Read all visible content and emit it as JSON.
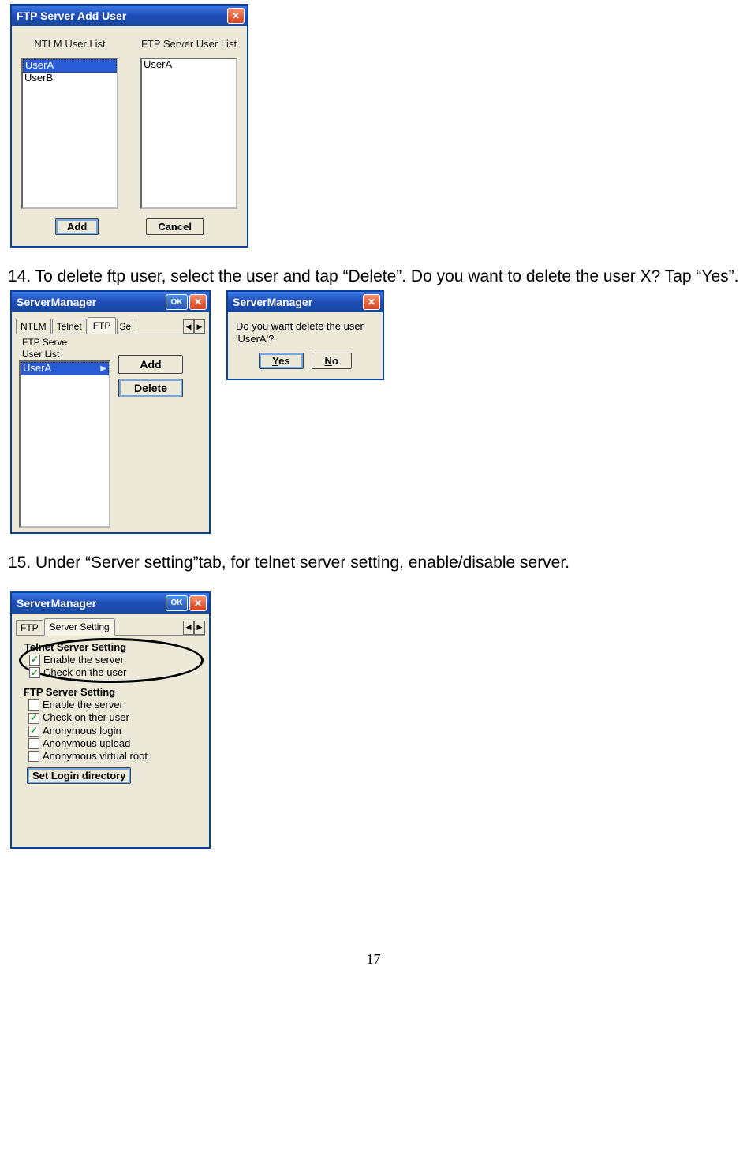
{
  "page_number": "17",
  "dialog1": {
    "title": "FTP Server Add User",
    "ntlm_label": "NTLM User List",
    "ftp_label": "FTP Server User List",
    "ntlm_users": [
      "UserA",
      "UserB"
    ],
    "ftp_users": [
      "UserA"
    ],
    "add_label": "Add",
    "cancel_label": "Cancel"
  },
  "para14": "14. To delete ftp user, select the user and tap “Delete”. Do you want to delete the user X? Tap “Yes”.",
  "dialog2": {
    "title": "ServerManager",
    "ok_label": "OK",
    "tabs": {
      "ntlm": "NTLM",
      "telnet": "Telnet",
      "ftp": "FTP",
      "partial": "Se"
    },
    "list_label_1": "FTP Serve",
    "list_label_2": "User List",
    "ftp_users": [
      "UserA"
    ],
    "add_label": "Add",
    "delete_label": "Delete"
  },
  "dialog3": {
    "title": "ServerManager",
    "message": "Do you want delete the user 'UserA'?",
    "yes_label": "Yes",
    "no_label": "No"
  },
  "para15": "15. Under “Server setting”tab, for telnet server setting, enable/disable server.",
  "dialog4": {
    "title": "ServerManager",
    "ok_label": "OK",
    "tabs": {
      "ftp": "FTP",
      "server": "Server Setting"
    },
    "telnet_group": "Telnet Server Setting",
    "telnet_enable": "Enable the server",
    "telnet_check": "Check on the user",
    "ftp_group": "FTP Server Setting",
    "ftp_enable": "Enable the server",
    "ftp_check": "Check on ther user",
    "ftp_anon_login": "Anonymous login",
    "ftp_anon_upload": "Anonymous upload",
    "ftp_anon_vroot": "Anonymous virtual root",
    "set_dir": "Set Login directory"
  }
}
